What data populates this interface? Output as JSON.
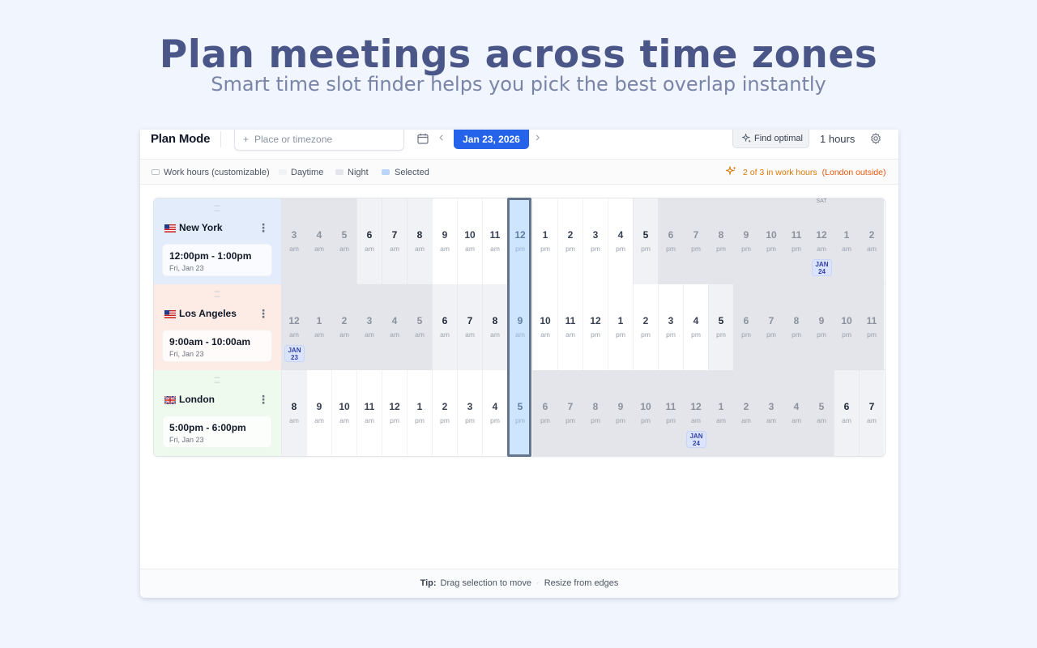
{
  "hero": {
    "title": "Plan meetings across time zones",
    "subtitle": "Smart time slot finder helps you pick the best overlap instantly"
  },
  "toolbar": {
    "mode_title": "Plan Mode",
    "place_placeholder": "Place or timezone",
    "date": "Jan 23, 2026",
    "find_optimal": "Find optimal",
    "duration": "1 hours",
    "icons": [
      "plus-icon",
      "calendar-icon",
      "chevron-left-icon",
      "chevron-right-icon",
      "sparkle-icon",
      "gear-icon"
    ]
  },
  "legend": {
    "work_hours": "Work hours (customizable)",
    "daytime": "Daytime",
    "night": "Night",
    "selected": "Selected",
    "status": "2 of 3 in work hours",
    "status_note": "(London outside)"
  },
  "colors": {
    "accent": "#2563eb",
    "night": "#e3e5ea",
    "daytime": "#f1f2f5",
    "selected": "#93c5fd",
    "status": "#d97706",
    "ny_bg": "#e3ecfb",
    "la_bg": "#fdece6",
    "london_bg": "#eefaee"
  },
  "rows": [
    {
      "city": "New York",
      "flag": "us-flag-icon",
      "time_range": "12:00pm - 1:00pm",
      "date": "Fri, Jan 23",
      "bg": "#e3ecfb",
      "hours": [
        {
          "h": "3",
          "ap": "am",
          "t": "night"
        },
        {
          "h": "4",
          "ap": "am",
          "t": "night"
        },
        {
          "h": "5",
          "ap": "am",
          "t": "night"
        },
        {
          "h": "6",
          "ap": "am",
          "t": "day"
        },
        {
          "h": "7",
          "ap": "am",
          "t": "day"
        },
        {
          "h": "8",
          "ap": "am",
          "t": "day"
        },
        {
          "h": "9",
          "ap": "am",
          "t": "work"
        },
        {
          "h": "10",
          "ap": "am",
          "t": "work"
        },
        {
          "h": "11",
          "ap": "am",
          "t": "work"
        },
        {
          "h": "12",
          "ap": "pm",
          "t": "work"
        },
        {
          "h": "1",
          "ap": "pm",
          "t": "work"
        },
        {
          "h": "2",
          "ap": "pm",
          "t": "work"
        },
        {
          "h": "3",
          "ap": "pm",
          "t": "work"
        },
        {
          "h": "4",
          "ap": "pm",
          "t": "work"
        },
        {
          "h": "5",
          "ap": "pm",
          "t": "day"
        },
        {
          "h": "6",
          "ap": "pm",
          "t": "night"
        },
        {
          "h": "7",
          "ap": "pm",
          "t": "night"
        },
        {
          "h": "8",
          "ap": "pm",
          "t": "night"
        },
        {
          "h": "9",
          "ap": "pm",
          "t": "night"
        },
        {
          "h": "10",
          "ap": "pm",
          "t": "night"
        },
        {
          "h": "11",
          "ap": "pm",
          "t": "night"
        },
        {
          "h": "12",
          "ap": "am",
          "t": "night",
          "top": "SAT",
          "badge": [
            "JAN",
            "24"
          ]
        },
        {
          "h": "1",
          "ap": "am",
          "t": "night"
        },
        {
          "h": "2",
          "ap": "am",
          "t": "night"
        }
      ]
    },
    {
      "city": "Los Angeles",
      "flag": "us-flag-icon",
      "time_range": "9:00am - 10:00am",
      "date": "Fri, Jan 23",
      "bg": "#fdece6",
      "hours": [
        {
          "h": "12",
          "ap": "am",
          "t": "night",
          "badge": [
            "JAN",
            "23"
          ]
        },
        {
          "h": "1",
          "ap": "am",
          "t": "night"
        },
        {
          "h": "2",
          "ap": "am",
          "t": "night"
        },
        {
          "h": "3",
          "ap": "am",
          "t": "night"
        },
        {
          "h": "4",
          "ap": "am",
          "t": "night"
        },
        {
          "h": "5",
          "ap": "am",
          "t": "night"
        },
        {
          "h": "6",
          "ap": "am",
          "t": "day"
        },
        {
          "h": "7",
          "ap": "am",
          "t": "day"
        },
        {
          "h": "8",
          "ap": "am",
          "t": "day"
        },
        {
          "h": "9",
          "ap": "am",
          "t": "work"
        },
        {
          "h": "10",
          "ap": "am",
          "t": "work"
        },
        {
          "h": "11",
          "ap": "am",
          "t": "work"
        },
        {
          "h": "12",
          "ap": "pm",
          "t": "work"
        },
        {
          "h": "1",
          "ap": "pm",
          "t": "work"
        },
        {
          "h": "2",
          "ap": "pm",
          "t": "work"
        },
        {
          "h": "3",
          "ap": "pm",
          "t": "work"
        },
        {
          "h": "4",
          "ap": "pm",
          "t": "work"
        },
        {
          "h": "5",
          "ap": "pm",
          "t": "day"
        },
        {
          "h": "6",
          "ap": "pm",
          "t": "night"
        },
        {
          "h": "7",
          "ap": "pm",
          "t": "night"
        },
        {
          "h": "8",
          "ap": "pm",
          "t": "night"
        },
        {
          "h": "9",
          "ap": "pm",
          "t": "night"
        },
        {
          "h": "10",
          "ap": "pm",
          "t": "night"
        },
        {
          "h": "11",
          "ap": "pm",
          "t": "night"
        }
      ]
    },
    {
      "city": "London",
      "flag": "uk-flag-icon",
      "time_range": "5:00pm - 6:00pm",
      "date": "Fri, Jan 23",
      "bg": "#eefaee",
      "hours": [
        {
          "h": "8",
          "ap": "am",
          "t": "day"
        },
        {
          "h": "9",
          "ap": "am",
          "t": "work"
        },
        {
          "h": "10",
          "ap": "am",
          "t": "work"
        },
        {
          "h": "11",
          "ap": "am",
          "t": "work"
        },
        {
          "h": "12",
          "ap": "pm",
          "t": "work"
        },
        {
          "h": "1",
          "ap": "pm",
          "t": "work"
        },
        {
          "h": "2",
          "ap": "pm",
          "t": "work"
        },
        {
          "h": "3",
          "ap": "pm",
          "t": "work"
        },
        {
          "h": "4",
          "ap": "pm",
          "t": "work"
        },
        {
          "h": "5",
          "ap": "pm",
          "t": "work"
        },
        {
          "h": "6",
          "ap": "pm",
          "t": "night"
        },
        {
          "h": "7",
          "ap": "pm",
          "t": "night"
        },
        {
          "h": "8",
          "ap": "pm",
          "t": "night"
        },
        {
          "h": "9",
          "ap": "pm",
          "t": "night"
        },
        {
          "h": "10",
          "ap": "pm",
          "t": "night"
        },
        {
          "h": "11",
          "ap": "pm",
          "t": "night"
        },
        {
          "h": "12",
          "ap": "am",
          "t": "night",
          "badge": [
            "JAN",
            "24"
          ]
        },
        {
          "h": "1",
          "ap": "am",
          "t": "night"
        },
        {
          "h": "2",
          "ap": "am",
          "t": "night"
        },
        {
          "h": "3",
          "ap": "am",
          "t": "night"
        },
        {
          "h": "4",
          "ap": "am",
          "t": "night"
        },
        {
          "h": "5",
          "ap": "am",
          "t": "night"
        },
        {
          "h": "6",
          "ap": "am",
          "t": "day"
        },
        {
          "h": "7",
          "ap": "am",
          "t": "day"
        }
      ]
    }
  ],
  "selected_index": 9,
  "footer": {
    "tip_label": "Tip:",
    "tip_1": "Drag selection to move",
    "separator": "·",
    "tip_2": "Resize from edges"
  }
}
